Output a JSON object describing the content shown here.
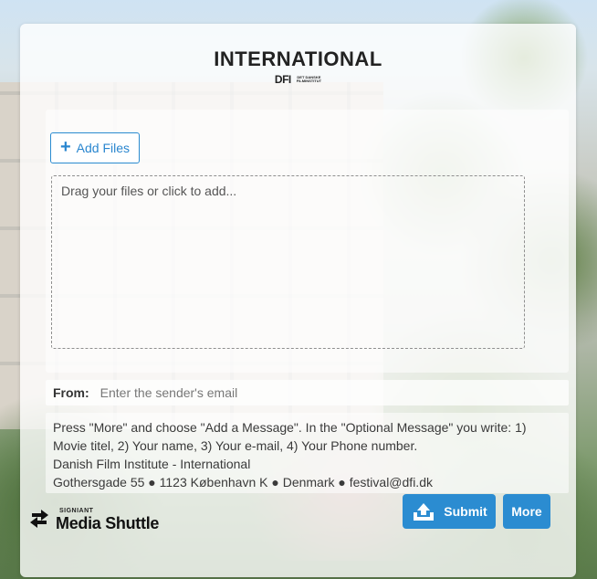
{
  "header": {
    "title": "INTERNATIONAL",
    "logo_mark": "DFI",
    "logo_tagline_1": "DET DANSKE",
    "logo_tagline_2": "FILMINSTITUT"
  },
  "upload": {
    "add_files_label": "Add Files",
    "drop_zone_text": "Drag your files or click to add..."
  },
  "from": {
    "label": "From:",
    "placeholder": "Enter the sender's email",
    "value": ""
  },
  "info": {
    "line1": "Press \"More\" and choose \"Add a Message\". In the \"Optional Message\" you write: 1) Movie titel, 2) Your name, 3) Your e-mail, 4) Your Phone number.",
    "line2": "Danish Film Institute - International",
    "line3": "Gothersgade 55 ● 1123 København K ● Denmark ● festival@dfi.dk"
  },
  "footer": {
    "brand_small": "SIGNIANT",
    "brand_name": "Media Shuttle",
    "submit_label": "Submit",
    "more_label": "More"
  },
  "colors": {
    "accent": "#2b8cd1",
    "panel": "#ffffff"
  },
  "icons": [
    "plus-icon",
    "upload-cloud-icon",
    "transfer-arrows-icon"
  ]
}
